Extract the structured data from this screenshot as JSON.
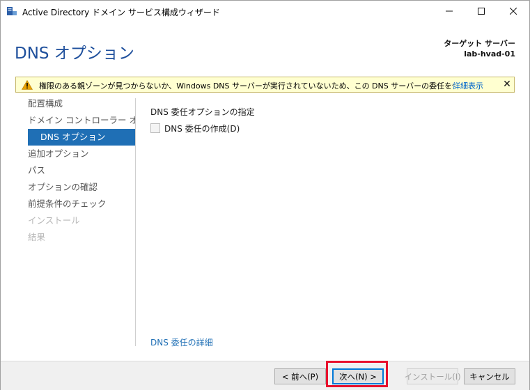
{
  "window": {
    "title": "Active Directory ドメイン サービス構成ウィザード",
    "icon": "server-wizard-icon"
  },
  "header": {
    "page_title": "DNS オプション",
    "target_label": "ターゲット サーバー",
    "target_server": "lab-hvad-01"
  },
  "warning": {
    "icon": "warning-triangle-icon",
    "text": "権限のある親ゾーンが見つからないか、Windows DNS サーバーが実行されていないため、この DNS サーバーの委任を作成でき...",
    "link": "詳細表示",
    "close": "✕"
  },
  "nav": {
    "items": [
      {
        "label": "配置構成"
      },
      {
        "label": "ドメイン コントローラー オプシ..."
      },
      {
        "label": "DNS オプション"
      },
      {
        "label": "追加オプション"
      },
      {
        "label": "パス"
      },
      {
        "label": "オプションの確認"
      },
      {
        "label": "前提条件のチェック"
      },
      {
        "label": "インストール"
      },
      {
        "label": "結果"
      }
    ],
    "selected_index": 2
  },
  "content": {
    "heading": "DNS 委任オプションの指定",
    "checkbox_label": "DNS 委任の作成(D)",
    "checkbox_checked": false,
    "more_link": "DNS 委任の詳細"
  },
  "footer": {
    "prev_label": "< 前へ(P)",
    "next_label": "次へ(N) >",
    "install_label": "インストール(I)",
    "cancel_label": "キャンセル"
  },
  "colors": {
    "accent": "#1f6fb5",
    "title_blue": "#1e4f9c",
    "warning_bg": "#ffffd0",
    "highlight": "#e8112d"
  }
}
